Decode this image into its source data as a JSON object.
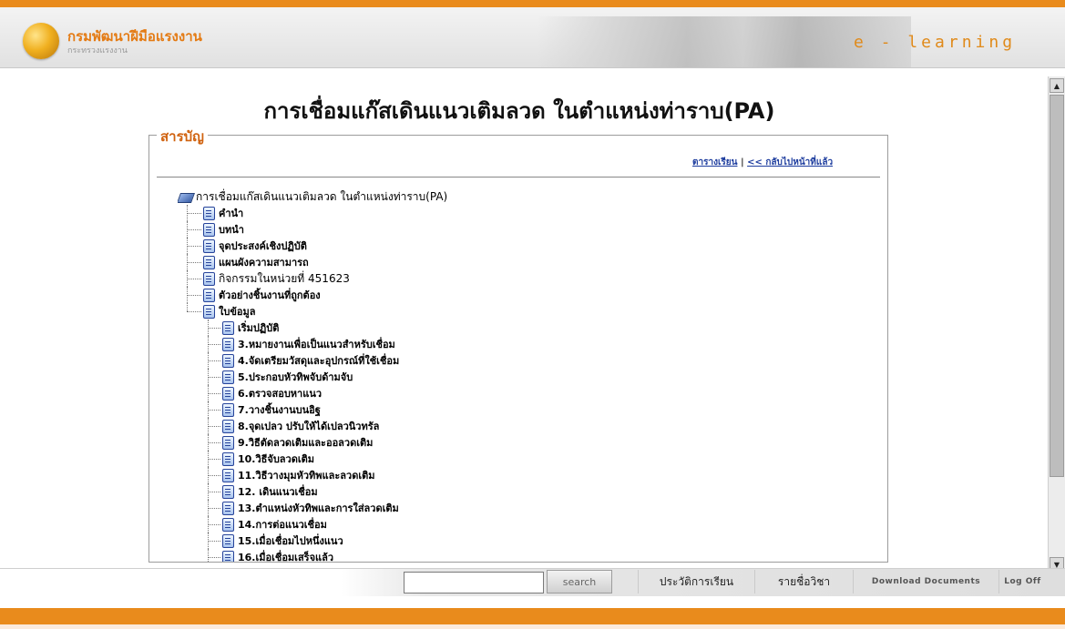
{
  "header": {
    "logo_title": "กรมพัฒนาฝีมือแรงงาน",
    "logo_subtitle": "กระทรวงแรงงาน",
    "banner_text": "e - learning"
  },
  "page": {
    "title": "การเชื่อมแก๊สเดินแนวเติมลวด ในตำแหน่งท่าราบ(PA)"
  },
  "toc": {
    "legend": "สารบัญ",
    "link_schedule": "ตารางเรียน",
    "link_separator": "|",
    "link_back": "<< กลับไปหน้าที่แล้ว",
    "root": "การเชื่อมแก๊สเดินแนวเติมลวด ในตำแหน่งท่าราบ(PA)",
    "items": [
      {
        "label": "คำนำ"
      },
      {
        "label": "บทนำ"
      },
      {
        "label": "จุดประสงค์เชิงปฏิบัติ"
      },
      {
        "label": "แผนผังความสามารถ"
      },
      {
        "label": "กิจกรรมในหน่วยที่ 451623"
      },
      {
        "label": "ตัวอย่างชิ้นงานที่ถูกต้อง"
      },
      {
        "label": "ใบข้อมูล"
      }
    ],
    "sub_items": [
      {
        "label": "เริ่มปฏิบัติ"
      },
      {
        "label": "3.หมายงานเพื่อเป็นแนวสำหรับเชื่อม"
      },
      {
        "label": "4.จัดเตรียมวัสดุและอุปกรณ์ที่ใช้เชื่อม"
      },
      {
        "label": "5.ประกอบหัวทิพจับด้ามจับ"
      },
      {
        "label": "6.ตรวจสอบหาแนว"
      },
      {
        "label": "7.วางชิ้นงานบนอิฐ"
      },
      {
        "label": "8.จุดเปลว ปรับให้ได้เปลวนิวทรัล"
      },
      {
        "label": "9.วิธีตัดลวดเติมและออลวดเติม"
      },
      {
        "label": "10.วิธีจับลวดเติม"
      },
      {
        "label": "11.วิธีวางมุมหัวทิพและลวดเติม"
      },
      {
        "label": "12. เดินแนวเชื่อม"
      },
      {
        "label": "13.ตำแหน่งหัวทิพและการใส่ลวดเติม"
      },
      {
        "label": "14.การต่อแนวเชื่อม"
      },
      {
        "label": "15.เมื่อเชื่อมไปหนึ่งแนว"
      },
      {
        "label": "16.เมื่อเชื่อมเสร็จแล้ว"
      }
    ]
  },
  "bottom": {
    "search_value": "",
    "search_button": "search",
    "history_button": "ประวัติการเรียน",
    "subjects_button": "รายชื่อวิชา",
    "download_button": "Download Documents",
    "logoff_button": "Log Off"
  },
  "colors": {
    "accent_orange": "#e98b1c",
    "legend_color": "#d0620f",
    "link_blue": "#1f3e9f"
  }
}
